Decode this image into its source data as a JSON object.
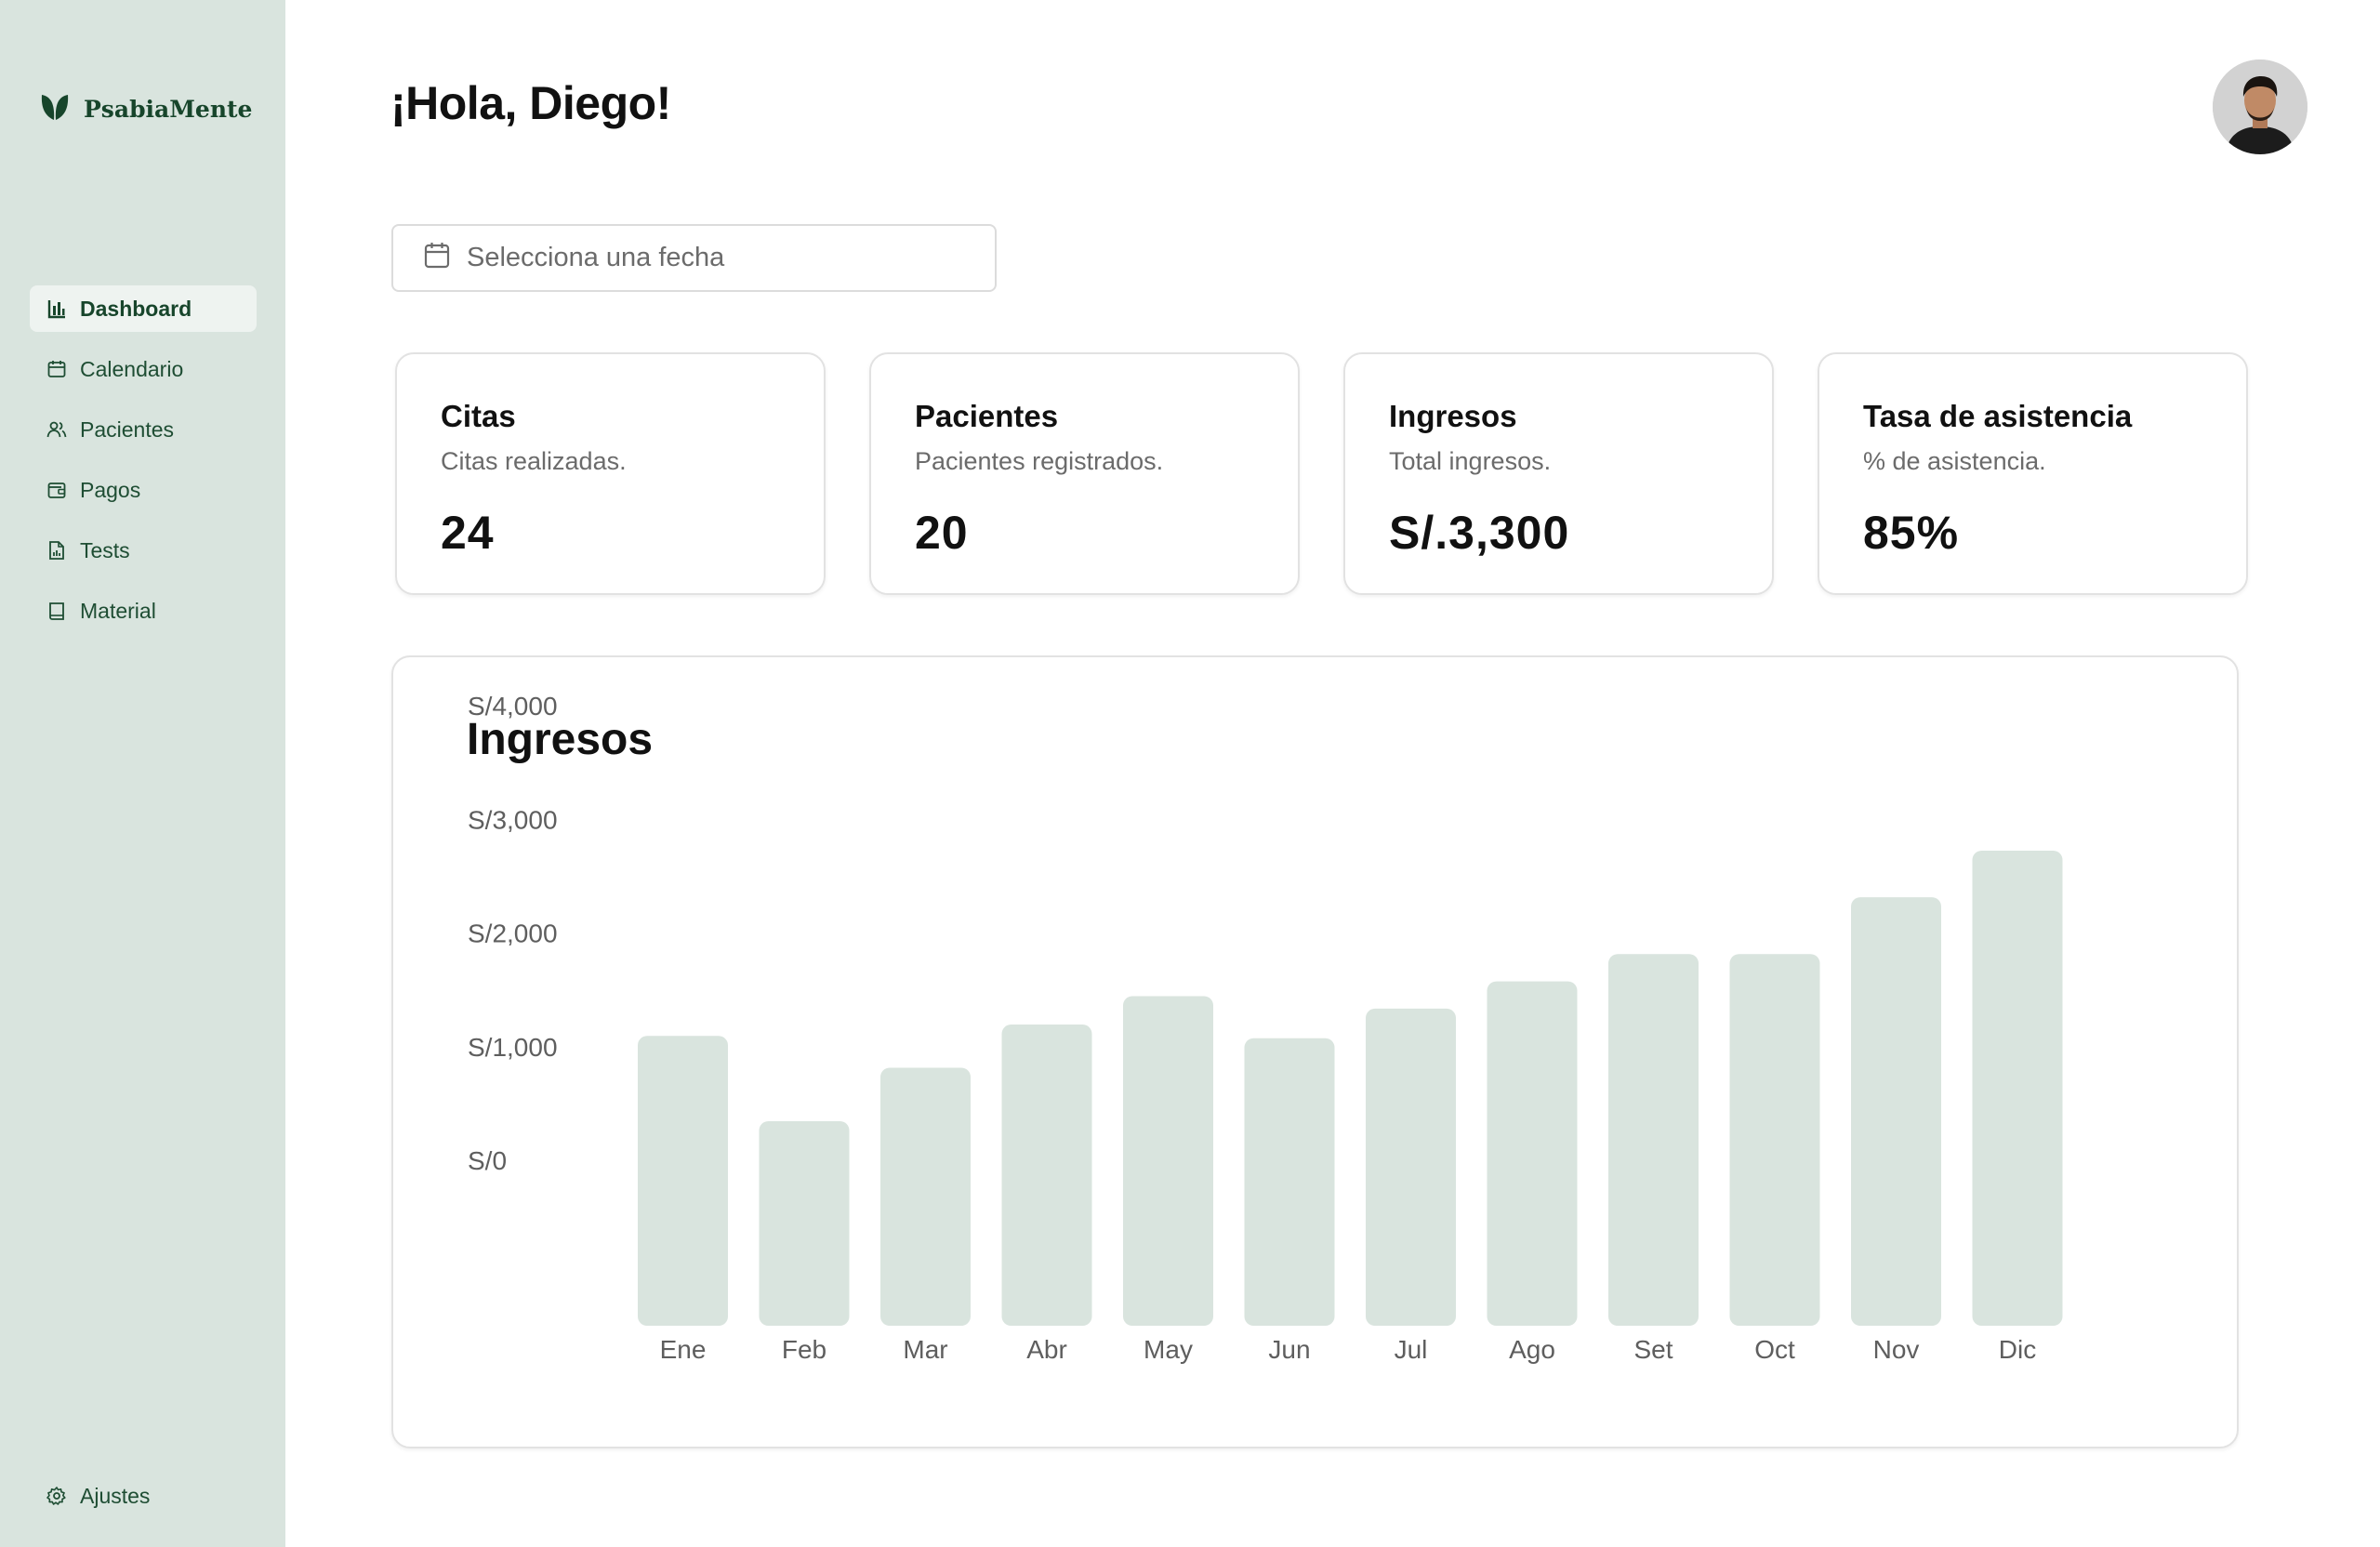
{
  "brand": {
    "name": "PsabiaMente"
  },
  "sidebar": {
    "items": [
      {
        "label": "Dashboard",
        "icon": "bar-chart-icon",
        "active": true
      },
      {
        "label": "Calendario",
        "icon": "calendar-icon"
      },
      {
        "label": "Pacientes",
        "icon": "users-icon"
      },
      {
        "label": "Pagos",
        "icon": "wallet-icon"
      },
      {
        "label": "Tests",
        "icon": "file-chart-icon"
      },
      {
        "label": "Material",
        "icon": "book-icon"
      }
    ],
    "settings": {
      "label": "Ajustes",
      "icon": "gear-icon"
    }
  },
  "header": {
    "greeting": "¡Hola, Diego!"
  },
  "date_picker": {
    "placeholder": "Selecciona una fecha"
  },
  "stats": [
    {
      "title": "Citas",
      "subtitle": "Citas realizadas.",
      "value": "24"
    },
    {
      "title": "Pacientes",
      "subtitle": "Pacientes registrados.",
      "value": "20"
    },
    {
      "title": "Ingresos",
      "subtitle": "Total ingresos.",
      "value": "S/.3,300"
    },
    {
      "title": "Tasa de asistencia",
      "subtitle": "% de asistencia.",
      "value": "85%"
    }
  ],
  "colors": {
    "sidebar_bg": "#d9e4de",
    "brand_green": "#17452b",
    "bar_fill": "#d9e4de"
  },
  "chart_data": {
    "type": "bar",
    "title": "Ingresos",
    "categories": [
      "Ene",
      "Feb",
      "Mar",
      "Abr",
      "May",
      "Jun",
      "Jul",
      "Ago",
      "Set",
      "Oct",
      "Nov",
      "Dic"
    ],
    "values": [
      2550,
      1800,
      2270,
      2650,
      2900,
      2530,
      2790,
      3030,
      3270,
      3270,
      3770,
      4180
    ],
    "y_ticks": [
      "S/4,000",
      "S/3,000",
      "S/2,000",
      "S/1,000",
      "S/0"
    ],
    "ylim": [
      0,
      4000
    ],
    "grid": false
  }
}
